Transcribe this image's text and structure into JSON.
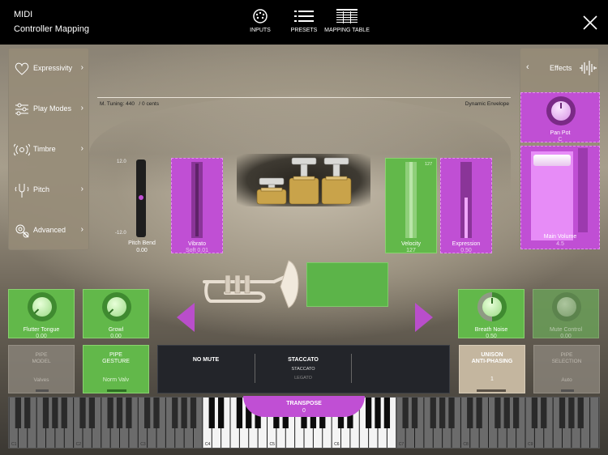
{
  "header": {
    "app": "MIDI",
    "title": "Controller Mapping",
    "nav": [
      "INPUTS",
      "PRESETS",
      "MAPPING TABLE"
    ],
    "close": "×"
  },
  "sidebar": {
    "items": [
      {
        "label": "Expressivity",
        "icon": "heart-icon"
      },
      {
        "label": "Play Modes",
        "icon": "sliders-icon"
      },
      {
        "label": "Timbre",
        "icon": "speaker-waves-icon"
      },
      {
        "label": "Pitch",
        "icon": "tuning-fork-icon"
      },
      {
        "label": "Advanced",
        "icon": "gear-magnifier-icon"
      }
    ],
    "chevron": "›"
  },
  "effects": {
    "back": "‹",
    "label": "Effects",
    "panpot": {
      "label": "Pan Pot",
      "value": "C"
    },
    "main_volume": {
      "label": "Main Volume",
      "value": "4.5"
    }
  },
  "status": {
    "tuning": "M. Tuning: 440",
    "cents": "/ 0 cents",
    "dynamic": "Dynamic Envelope"
  },
  "pitchbend": {
    "label": "Pitch Bend",
    "value": "0.00",
    "max": "12.0",
    "min": "-12.0"
  },
  "vibrato": {
    "label": "Vibrato",
    "value": "Soft 0.01",
    "max": "1",
    "min": "0"
  },
  "velocity": {
    "label": "Velocity",
    "value": "127",
    "max": "127",
    "min": "0"
  },
  "expression": {
    "label": "Expression",
    "value": "0.50",
    "max": "1",
    "min": "0"
  },
  "knobs": [
    {
      "label": "Flutter Tongue",
      "value": "0.00"
    },
    {
      "label": "Growl",
      "value": "0.00"
    },
    {
      "label": "Breath Noise",
      "value": "0.50"
    },
    {
      "label": "Mute Control",
      "value": "0.00"
    }
  ],
  "pipe_model": {
    "title1": "PIPE",
    "title2": "MODEL",
    "value": "Valves"
  },
  "pipe_gesture": {
    "title1": "PIPE",
    "title2": "GESTURE",
    "value": "Norm Valv"
  },
  "mute": {
    "label": "NO MUTE"
  },
  "articulation": {
    "label": "STACCATO",
    "current": "STACCATO",
    "next": "LEGATO"
  },
  "unison": {
    "title1": "UNISON",
    "title2": "ANTI-PHASING",
    "value": "1"
  },
  "pipe_selection": {
    "title1": "PIPE",
    "title2": "SELECTION",
    "value": "Auto"
  },
  "transpose": {
    "label": "TRANSPOSE",
    "value": "0"
  },
  "octaves": [
    "C1",
    "C2",
    "C3",
    "C4",
    "C5",
    "C6",
    "C7",
    "C8",
    "C9"
  ],
  "colors": {
    "accent_purple": "#c04fd4",
    "accent_green": "#62b84a"
  }
}
